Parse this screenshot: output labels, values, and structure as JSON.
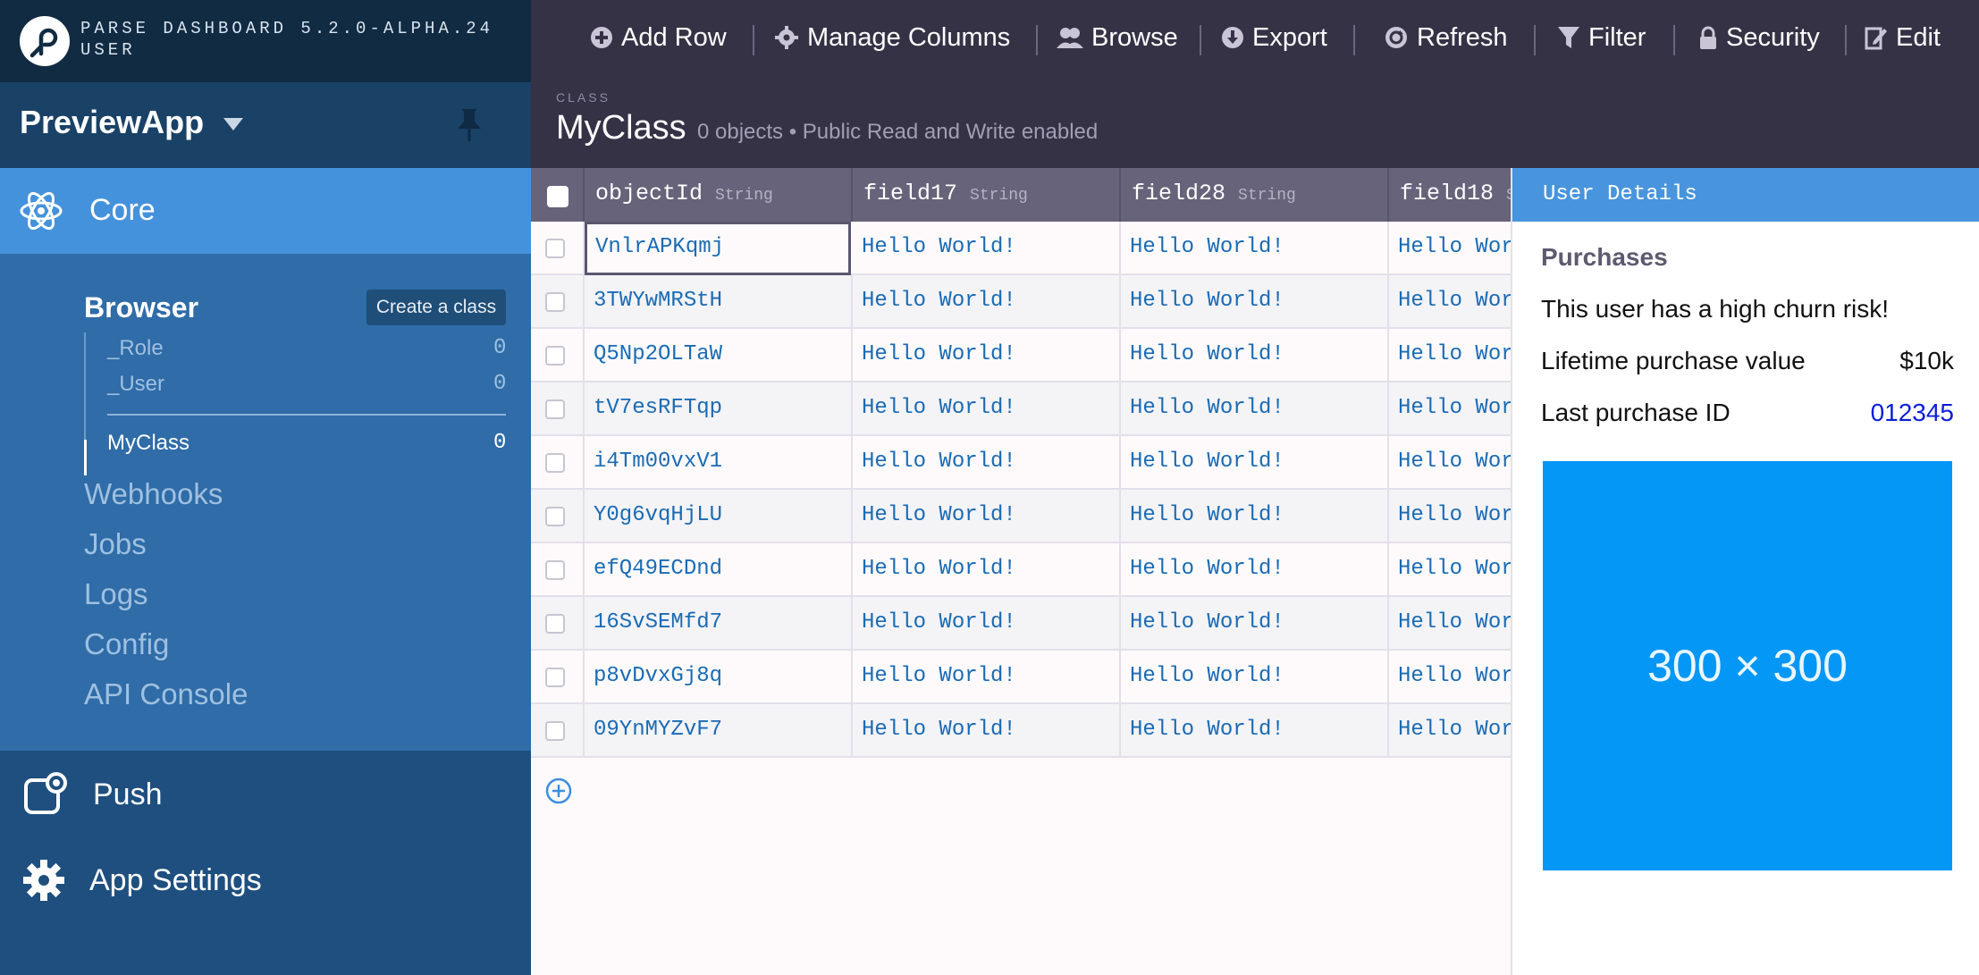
{
  "sidebar": {
    "version_line1": "PARSE DASHBOARD 5.2.0-ALPHA.24",
    "version_line2": "USER",
    "app_name": "PreviewApp",
    "core_label": "Core",
    "browser_label": "Browser",
    "create_class_label": "Create a class",
    "classes": [
      {
        "name": "_Role",
        "count": "0"
      },
      {
        "name": "_User",
        "count": "0"
      },
      {
        "name": "MyClass",
        "count": "0"
      }
    ],
    "links": [
      "Webhooks",
      "Jobs",
      "Logs",
      "Config",
      "API Console"
    ],
    "push_label": "Push",
    "settings_label": "App Settings"
  },
  "toolbar": {
    "items": [
      "Add Row",
      "Manage Columns",
      "Browse",
      "Export",
      "Refresh",
      "Filter",
      "Security",
      "Edit"
    ]
  },
  "class_header": {
    "subtitle": "CLASS",
    "name": "MyClass",
    "meta": "0 objects • Public Read and Write enabled"
  },
  "grid": {
    "columns": [
      {
        "name": "objectId",
        "type": "String"
      },
      {
        "name": "field17",
        "type": "String"
      },
      {
        "name": "field28",
        "type": "String"
      },
      {
        "name": "field18",
        "type": "String"
      }
    ],
    "rows": [
      {
        "objectId": "VnlrAPKqmj",
        "field17": "Hello World!",
        "field28": "Hello World!",
        "field18": "Hello World!"
      },
      {
        "objectId": "3TWYwMRStH",
        "field17": "Hello World!",
        "field28": "Hello World!",
        "field18": "Hello World!"
      },
      {
        "objectId": "Q5Np2OLTaW",
        "field17": "Hello World!",
        "field28": "Hello World!",
        "field18": "Hello World!"
      },
      {
        "objectId": "tV7esRFTqp",
        "field17": "Hello World!",
        "field28": "Hello World!",
        "field18": "Hello World!"
      },
      {
        "objectId": "i4Tm00vxV1",
        "field17": "Hello World!",
        "field28": "Hello World!",
        "field18": "Hello World!"
      },
      {
        "objectId": "Y0g6vqHjLU",
        "field17": "Hello World!",
        "field28": "Hello World!",
        "field18": "Hello World!"
      },
      {
        "objectId": "efQ49ECDnd",
        "field17": "Hello World!",
        "field28": "Hello World!",
        "field18": "Hello World!"
      },
      {
        "objectId": "16SvSEMfd7",
        "field17": "Hello World!",
        "field28": "Hello World!",
        "field18": "Hello World!"
      },
      {
        "objectId": "p8vDvxGj8q",
        "field17": "Hello World!",
        "field28": "Hello World!",
        "field18": "Hello World!"
      },
      {
        "objectId": "09YnMYZvF7",
        "field17": "Hello World!",
        "field28": "Hello World!",
        "field18": "Hello World!"
      }
    ]
  },
  "panel": {
    "title": "User Details",
    "heading": "Purchases",
    "churn_text": "This user has a high churn risk!",
    "lifetime_label": "Lifetime purchase value",
    "lifetime_value": "$10k",
    "last_id_label": "Last purchase ID",
    "last_id_value": "012345",
    "image_label": "300 × 300"
  },
  "colors": {
    "sidebar_bg": "#1e4f7f",
    "core_active": "#4592dc",
    "toolbar_bg": "#363246",
    "panel_header": "#4895dd",
    "image_bg": "#0497f6",
    "link": "#0a1fd6"
  },
  "icons": {
    "toolbar": [
      "plus-icon",
      "gear-icon",
      "users-icon",
      "download-icon",
      "refresh-icon",
      "filter-icon",
      "lock-icon",
      "edit-icon"
    ]
  }
}
